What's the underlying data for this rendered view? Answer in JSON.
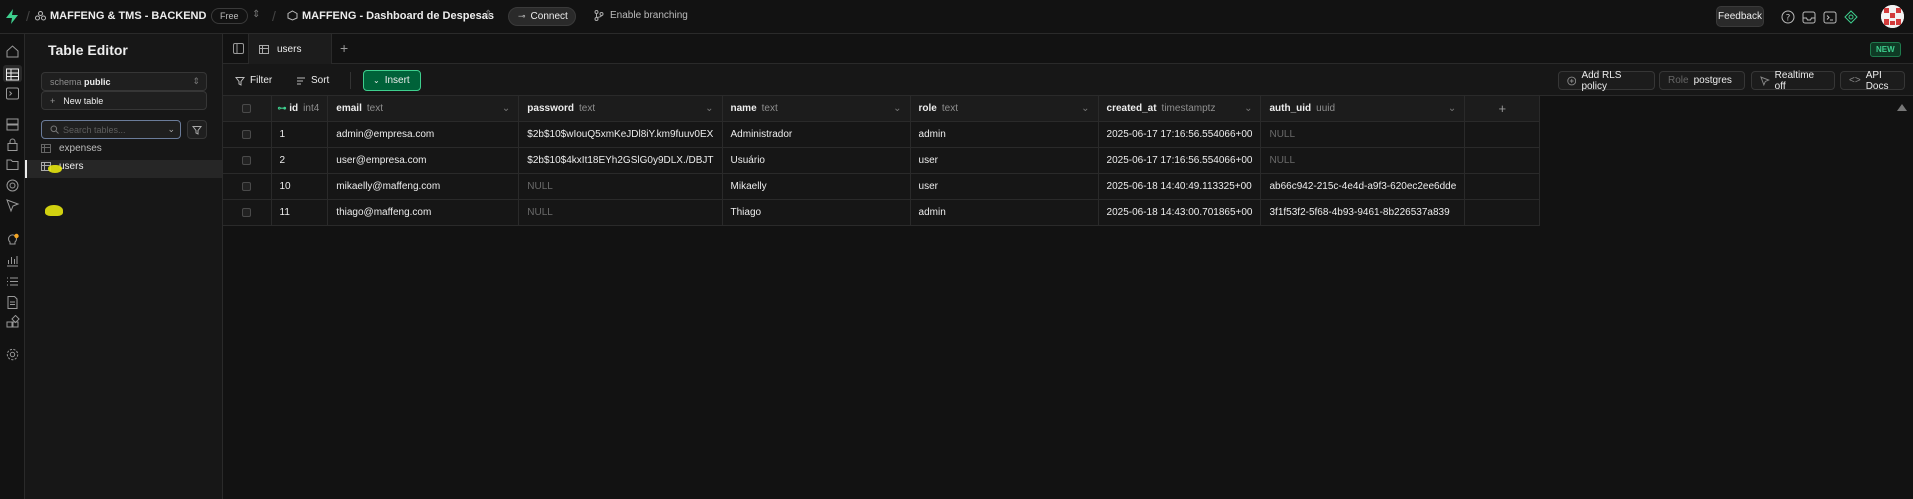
{
  "topbar": {
    "org_name": "MAFFENG & TMS - BACKEND",
    "plan_badge": "Free",
    "project_name": "MAFFENG - Dashboard de Despesas",
    "connect_label": "Connect",
    "branching_label": "Enable branching",
    "feedback_label": "Feedback",
    "accent_color": "#3ecf8e"
  },
  "sidebar": {
    "title": "Table Editor",
    "schema_prefix": "schema",
    "schema_value": "public",
    "new_table_label": "New table",
    "search_placeholder": "Search tables...",
    "tables": [
      {
        "label": "expenses",
        "active": false
      },
      {
        "label": "users",
        "active": true
      }
    ]
  },
  "tabs": {
    "items": [
      {
        "label": "users"
      }
    ],
    "new_badge": "NEW"
  },
  "toolbar": {
    "filter_label": "Filter",
    "sort_label": "Sort",
    "insert_label": "Insert",
    "rls_label": "Add RLS policy",
    "role_prefix": "Role",
    "role_value": "postgres",
    "realtime_label": "Realtime off",
    "api_docs_label": "API Docs"
  },
  "grid": {
    "columns": [
      {
        "name": "id",
        "type": "int4"
      },
      {
        "name": "email",
        "type": "text"
      },
      {
        "name": "password",
        "type": "text"
      },
      {
        "name": "name",
        "type": "text"
      },
      {
        "name": "role",
        "type": "text"
      },
      {
        "name": "created_at",
        "type": "timestamptz"
      },
      {
        "name": "auth_uid",
        "type": "uuid"
      }
    ],
    "rows": [
      [
        "1",
        "admin@empresa.com",
        "$2b$10$wIouQ5xmKeJDl8iY.km9fuuv0EX",
        "Administrador",
        "admin",
        "2025-06-17 17:16:56.554066+00",
        "NULL"
      ],
      [
        "2",
        "user@empresa.com",
        "$2b$10$4kxIt18EYh2GSlG0y9DLX./DBJT",
        "Usuário",
        "user",
        "2025-06-17 17:16:56.554066+00",
        "NULL"
      ],
      [
        "10",
        "mikaelly@maffeng.com",
        "NULL",
        "Mikaelly",
        "user",
        "2025-06-18 14:40:49.113325+00",
        "ab66c942-215c-4e4d-a9f3-620ec2ee6dde"
      ],
      [
        "11",
        "thiago@maffeng.com",
        "NULL",
        "Thiago",
        "admin",
        "2025-06-18 14:43:00.701865+00",
        "3f1f53f2-5f68-4b93-9461-8b226537a839"
      ]
    ]
  }
}
